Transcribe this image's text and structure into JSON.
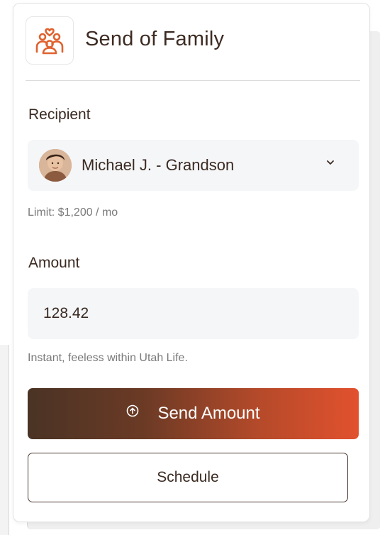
{
  "header": {
    "title": "Send of Family",
    "logo_icon": "family-icon"
  },
  "recipient": {
    "label": "Recipient",
    "selected_value": "Michael J. - Grandson",
    "limit_hint": "Limit: $1,200 / mo"
  },
  "amount": {
    "label": "Amount",
    "value": "128.42",
    "hint": "Instant, feeless within Utah Life."
  },
  "actions": {
    "send_label": "Send Amount",
    "send_icon": "arrow-up-circle-icon",
    "schedule_label": "Schedule"
  },
  "colors": {
    "accent": "#e2512e",
    "accent_dark": "#4a3325",
    "brand_icon": "#e0622e",
    "text_primary": "#3b2a22",
    "text_hint": "#7a7a7a",
    "field_bg": "#f5f6f8"
  }
}
